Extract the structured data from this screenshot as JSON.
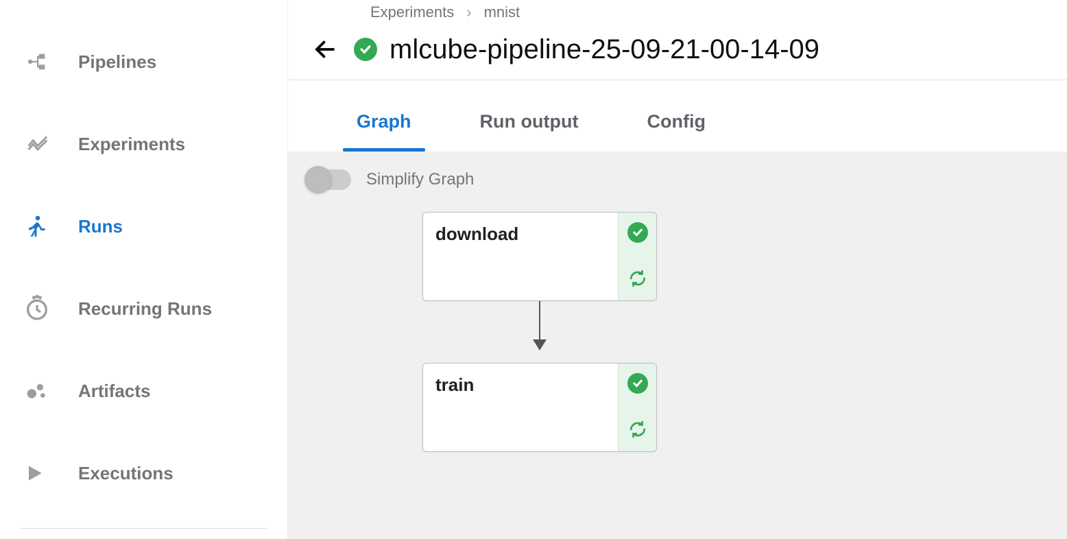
{
  "sidebar": {
    "items": [
      {
        "label": "Pipelines"
      },
      {
        "label": "Experiments"
      },
      {
        "label": "Runs"
      },
      {
        "label": "Recurring Runs"
      },
      {
        "label": "Artifacts"
      },
      {
        "label": "Executions"
      }
    ]
  },
  "breadcrumb": {
    "items": [
      "Experiments",
      "mnist"
    ]
  },
  "header": {
    "title": "mlcube-pipeline-25-09-21-00-14-09",
    "status": "success"
  },
  "tabs": [
    {
      "label": "Graph",
      "active": true
    },
    {
      "label": "Run output"
    },
    {
      "label": "Config"
    }
  ],
  "graph": {
    "simplify_label": "Simplify Graph",
    "simplify_on": false,
    "nodes": [
      {
        "label": "download",
        "status": "success"
      },
      {
        "label": "train",
        "status": "success"
      }
    ]
  }
}
